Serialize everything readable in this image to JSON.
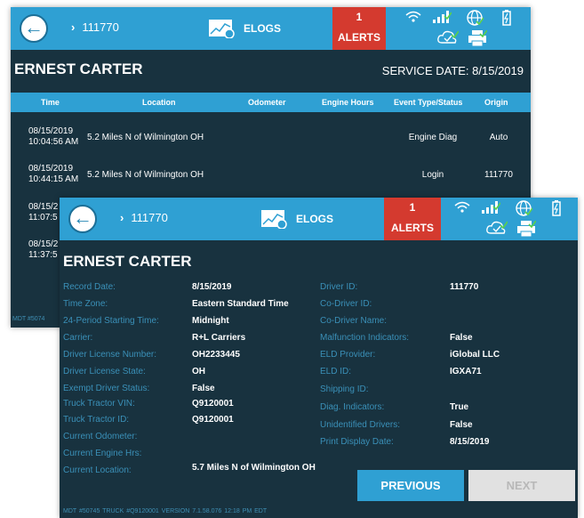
{
  "back": {
    "breadcrumb": "111770",
    "elogs_label": "ELOGS",
    "alerts_count": "1",
    "alerts_label": "ALERTS",
    "driver_name": "ERNEST CARTER",
    "service_date": "SERVICE DATE: 8/15/2019",
    "columns": [
      "Time",
      "Location",
      "Odometer",
      "Engine Hours",
      "Event Type/Status",
      "Origin"
    ],
    "rows": [
      {
        "date": "08/15/2019",
        "clock": "10:04:56 AM",
        "location": "5.2 Miles N of Wilmington OH",
        "event": "Engine Diag",
        "origin": "Auto"
      },
      {
        "date": "08/15/2019",
        "clock": "10:44:15 AM",
        "location": "5.2 Miles N of Wilmington OH",
        "event": "Login",
        "origin": "111770"
      }
    ],
    "partial_rows": [
      {
        "date": "08/15/2",
        "clock": "11:07:5"
      },
      {
        "date": "08/15/2",
        "clock": "11:37:5"
      }
    ],
    "footer": "MDT #5074"
  },
  "front": {
    "breadcrumb": "111770",
    "elogs_label": "ELOGS",
    "alerts_count": "1",
    "alerts_label": "ALERTS",
    "driver_name": "ERNEST CARTER",
    "left_fields": [
      {
        "label": "Record Date:",
        "value": "8/15/2019"
      },
      {
        "label": "Time Zone:",
        "value": "Eastern Standard Time"
      },
      {
        "label": "24-Period Starting Time:",
        "value": "Midnight"
      },
      {
        "label": "Carrier:",
        "value": "R+L Carriers"
      },
      {
        "label": "Driver License Number:",
        "value": "OH2233445"
      },
      {
        "label": "Driver License State:",
        "value": "OH"
      },
      {
        "label": "Exempt Driver Status:",
        "value": "False"
      },
      {
        "label": "Truck Tractor VIN:",
        "value": "Q9120001"
      },
      {
        "label": "Truck Tractor ID:",
        "value": "Q9120001"
      },
      {
        "label": "Current Odometer:",
        "value": ""
      },
      {
        "label": "Current Engine Hrs:",
        "value": ""
      },
      {
        "label": "Current Location:",
        "value": "5.7 Miles N of Wilmington OH"
      }
    ],
    "right_fields": [
      {
        "label": "Driver ID:",
        "value": "111770"
      },
      {
        "label": "Co-Driver ID:",
        "value": ""
      },
      {
        "label": "Co-Driver Name:",
        "value": ""
      },
      {
        "label": "Malfunction Indicators:",
        "value": "False"
      },
      {
        "label": "ELD Provider:",
        "value": "iGlobal LLC"
      },
      {
        "label": "ELD ID:",
        "value": "IGXA71"
      },
      {
        "label": "Shipping ID:",
        "value": ""
      },
      {
        "label": "Diag. Indicators:",
        "value": "True"
      },
      {
        "label": "Unidentified Drivers:",
        "value": "False"
      },
      {
        "label": "Print Display Date:",
        "value": "8/15/2019"
      }
    ],
    "previous_label": "PREVIOUS",
    "next_label": "NEXT",
    "footer": "MDT #50745   TRUCK #Q9120001   VERSION  7.1.58.076    12:18 PM EDT"
  },
  "icons": [
    "back-arrow-icon",
    "chevron-right-icon",
    "elogs-chart-icon",
    "wifi-icon",
    "signal-bars-icon",
    "globe-icon",
    "battery-icon",
    "cloud-check-icon",
    "printer-icon"
  ],
  "colors": {
    "header_blue": "#2fa0d3",
    "alert_red": "#d43a2f",
    "background": "#18323f",
    "label_blue": "#3a90b8",
    "disabled_gray": "#e1e1e1"
  }
}
